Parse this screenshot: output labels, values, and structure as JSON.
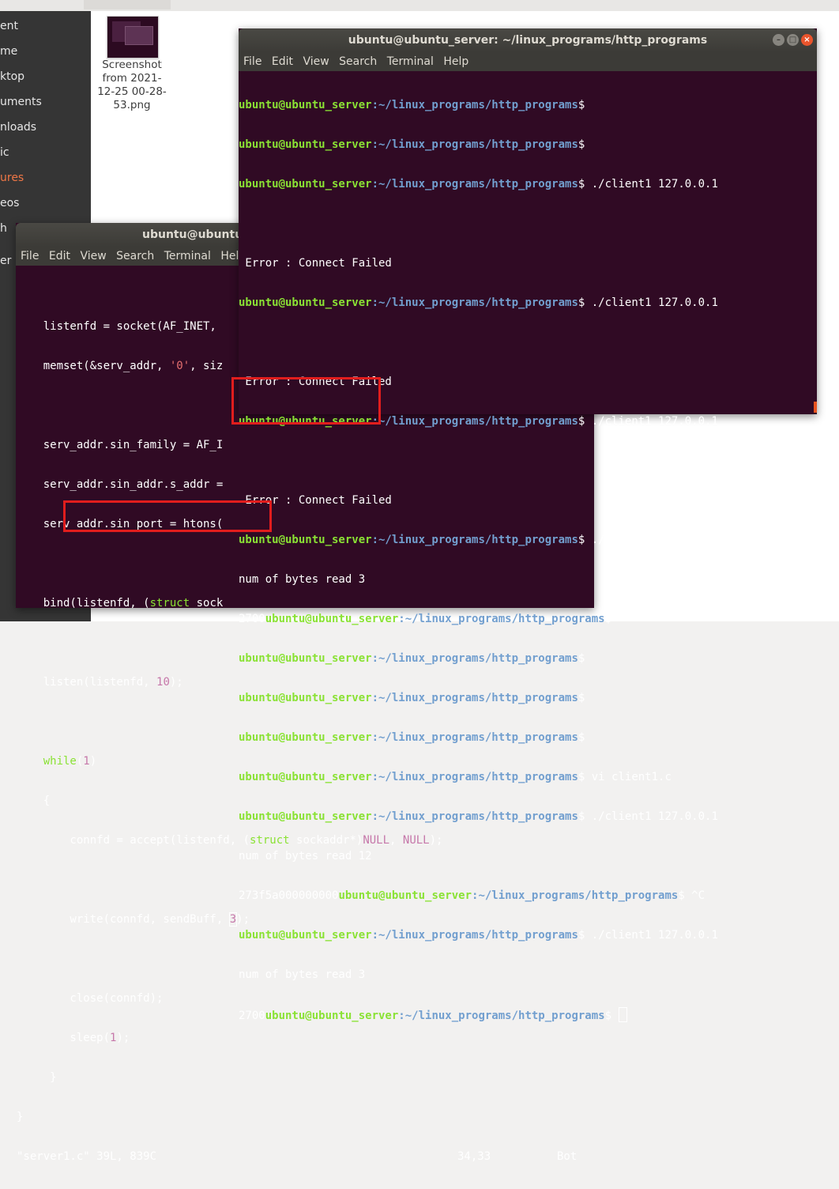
{
  "file_manager": {
    "sidebar_items": [
      {
        "label": "ent"
      },
      {
        "label": "me"
      },
      {
        "label": "ktop"
      },
      {
        "label": "uments"
      },
      {
        "label": "nloads"
      },
      {
        "label": "ic"
      },
      {
        "label": "ures",
        "active": true
      },
      {
        "label": "eos"
      },
      {
        "label": "h"
      },
      {
        "label": "er L"
      }
    ],
    "file": {
      "name_lines": [
        "Screenshot",
        "from 2021-",
        "12-25 00-28-",
        "53.png"
      ],
      "icon": "image-thumbnail-icon"
    }
  },
  "term_front": {
    "title": "ubuntu@ubuntu_server: ~/linux_programs/http_programs",
    "menu": [
      "File",
      "Edit",
      "View",
      "Search",
      "Terminal",
      "Help"
    ],
    "user_host": "ubuntu@ubuntu_server",
    "path": ":~/linux_programs/http_programs",
    "cmd_client": " ./client1 127.0.0.1",
    "cmd_vi": " vi client1.c",
    "error": " Error : Connect Failed",
    "bytes_3": "num of bytes read 3",
    "bytes_12": "num of bytes read 12",
    "data_2700": "2700",
    "data_hex": "273f5a000000000",
    "ctrl_c": " ^C",
    "dollar": "$"
  },
  "term_back": {
    "title": "ubuntu@ubuntu",
    "menu": [
      "File",
      "Edit",
      "View",
      "Search",
      "Terminal",
      "Help"
    ],
    "code": {
      "l1a": "    listenfd = socket(AF_INET,",
      "l2a": "    memset(&serv_addr, ",
      "l2b": "'0'",
      "l2c": ", siz",
      "l3": "    serv_addr.sin_family = AF_I",
      "l4": "    serv_addr.sin_addr.s_addr =",
      "l5": "    serv_addr.sin_port = htons(",
      "l6a": "    bind(listenfd, (",
      "l6b": "struct",
      "l6c": " sock",
      "l7a": "    listen(listenfd, ",
      "l7b": "10",
      "l7c": ");",
      "l8a": "    while",
      "l8b": "(",
      "l8c": "1",
      "l8d": ")",
      "l9": "    {",
      "l10a": "        connfd = accept(listenfd, (",
      "l10b": "struct",
      "l10c": " sockaddr*)",
      "l10d": "NULL",
      "l10e": ", ",
      "l10f": "NULL",
      "l10g": ");",
      "l11a": "        write(connfd, sendBuff, ",
      "l11b": "3",
      "l11c": ");",
      "l12": "        close(connfd);",
      "l13a": "        sleep(",
      "l13b": "1",
      "l13c": ");",
      "l14": "     }",
      "l15": "}"
    },
    "status_file": "\"server1.c\" 39L, 839C",
    "status_pos": "34,33",
    "status_scroll": "Bot"
  }
}
